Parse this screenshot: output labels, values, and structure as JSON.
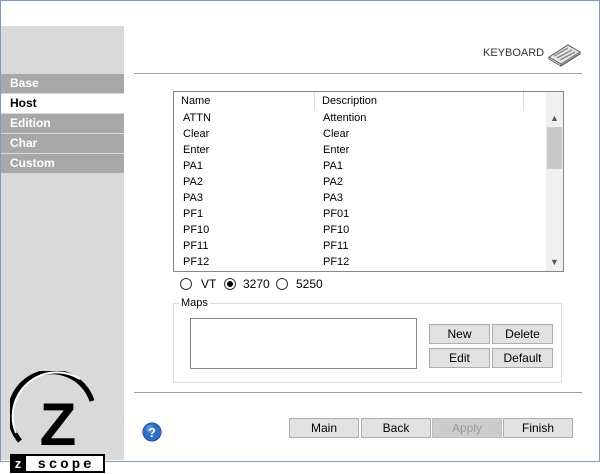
{
  "sidebar": {
    "items": [
      {
        "label": "Base",
        "active": false
      },
      {
        "label": "Host",
        "active": true
      },
      {
        "label": "Edition",
        "active": false
      },
      {
        "label": "Char",
        "active": false
      },
      {
        "label": "Custom",
        "active": false
      }
    ]
  },
  "logo": {
    "letter": "Z",
    "word": "scope",
    "prefix": "z"
  },
  "header": {
    "section_label": "KEYBOARD",
    "icon": "keyboard-icon"
  },
  "keys_list": {
    "columns": [
      "Name",
      "Description"
    ],
    "rows": [
      [
        "ATTN",
        "Attention"
      ],
      [
        "Clear",
        "Clear"
      ],
      [
        "Enter",
        "Enter"
      ],
      [
        "PA1",
        "PA1"
      ],
      [
        "PA2",
        "PA2"
      ],
      [
        "PA3",
        "PA3"
      ],
      [
        "PF1",
        "PF01"
      ],
      [
        "PF10",
        "PF10"
      ],
      [
        "PF11",
        "PF11"
      ],
      [
        "PF12",
        "PF12"
      ]
    ]
  },
  "terminal_type": {
    "options": [
      "VT",
      "3270",
      "5250"
    ],
    "selected": "3270"
  },
  "maps": {
    "legend": "Maps",
    "new_label": "New",
    "delete_label": "Delete",
    "edit_label": "Edit",
    "default_label": "Default"
  },
  "footer": {
    "main_label": "Main",
    "back_label": "Back",
    "apply_label": "Apply",
    "finish_label": "Finish"
  }
}
